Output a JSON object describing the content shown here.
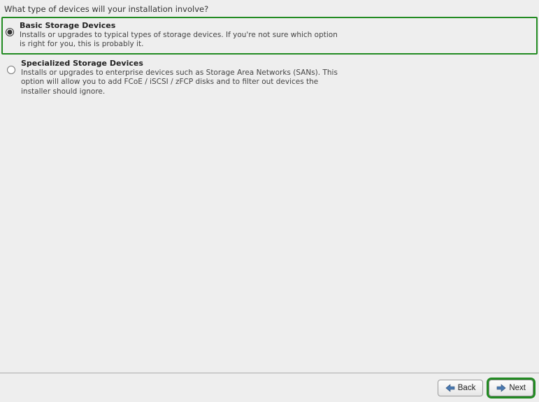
{
  "title": "What type of devices will your installation involve?",
  "options": [
    {
      "title": "Basic Storage Devices",
      "description": "Installs or upgrades to typical types of storage devices.  If you're not sure which option is right for you, this is probably it.",
      "selected": true
    },
    {
      "title": "Specialized Storage Devices",
      "description": "Installs or upgrades to enterprise devices such as Storage Area Networks (SANs). This option will allow you to add FCoE / iSCSI / zFCP disks and to filter out devices the installer should ignore.",
      "selected": false
    }
  ],
  "buttons": {
    "back": "Back",
    "next": "Next"
  }
}
